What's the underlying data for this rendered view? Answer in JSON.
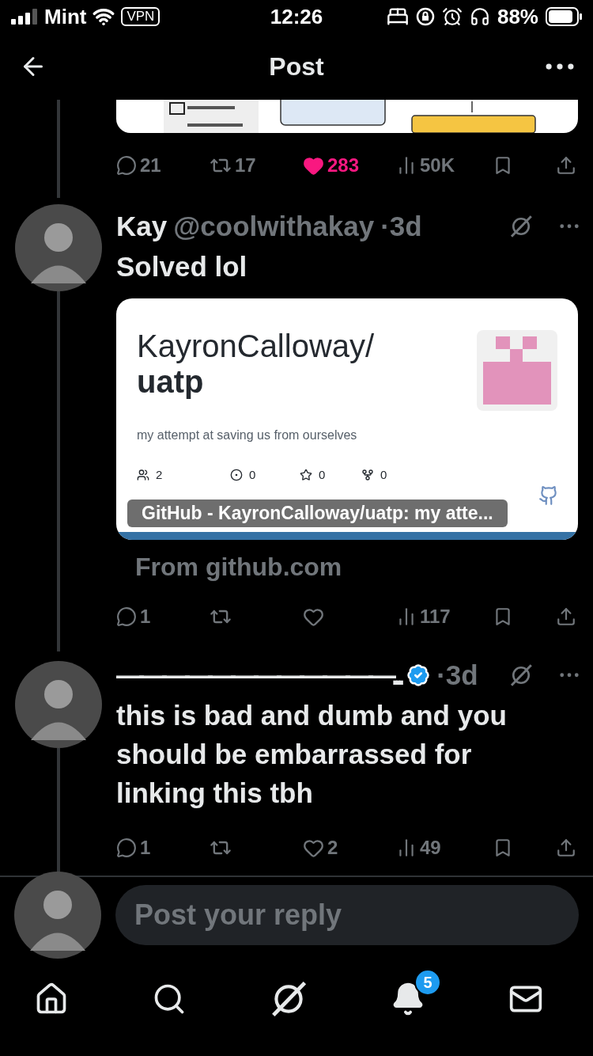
{
  "status_bar": {
    "carrier": "Mint",
    "vpn": "VPN",
    "time": "12:26",
    "battery": "88%"
  },
  "header": {
    "title": "Post"
  },
  "posts": [
    {
      "kind": "media",
      "actions": {
        "replies": "21",
        "reposts": "17",
        "likes": "283",
        "liked": true,
        "views": "50K"
      }
    },
    {
      "kind": "link",
      "author": {
        "name": "Kay",
        "handle": "@coolwithakay"
      },
      "time": "·3d",
      "text": "Solved lol",
      "link_card": {
        "owner": "KayronCalloway/",
        "repo": "uatp",
        "description": "my attempt at saving us from ourselves",
        "stats": [
          {
            "kind": "contributors",
            "value": "2"
          },
          {
            "kind": "issues",
            "value": "0"
          },
          {
            "kind": "stars",
            "value": "0"
          },
          {
            "kind": "forks",
            "value": "0"
          }
        ],
        "title": "GitHub - KayronCalloway/uatp: my atte...",
        "source": "From github.com"
      },
      "actions": {
        "replies": "1",
        "liked": false,
        "views": "117"
      }
    },
    {
      "kind": "text",
      "author": {
        "name": "————————————...",
        "verified": true
      },
      "time": "·3d",
      "text": "this is bad and dumb and you should be embarrassed for linking this tbh",
      "actions": {
        "replies": "1",
        "likes": "2",
        "liked": false,
        "views": "49"
      }
    }
  ],
  "reply_bar": {
    "placeholder": "Post your reply"
  },
  "tab_bar": [
    {
      "kind": "home"
    },
    {
      "kind": "search"
    },
    {
      "kind": "grok"
    },
    {
      "kind": "notifications",
      "badge": "5"
    },
    {
      "kind": "messages"
    }
  ]
}
